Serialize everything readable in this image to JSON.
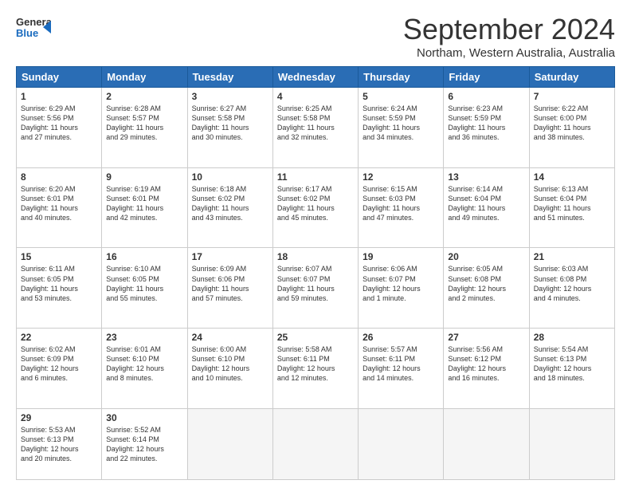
{
  "header": {
    "logo_line1": "General",
    "logo_line2": "Blue",
    "month": "September 2024",
    "location": "Northam, Western Australia, Australia"
  },
  "weekdays": [
    "Sunday",
    "Monday",
    "Tuesday",
    "Wednesday",
    "Thursday",
    "Friday",
    "Saturday"
  ],
  "weeks": [
    [
      {
        "day": "1",
        "info": "Sunrise: 6:29 AM\nSunset: 5:56 PM\nDaylight: 11 hours\nand 27 minutes."
      },
      {
        "day": "2",
        "info": "Sunrise: 6:28 AM\nSunset: 5:57 PM\nDaylight: 11 hours\nand 29 minutes."
      },
      {
        "day": "3",
        "info": "Sunrise: 6:27 AM\nSunset: 5:58 PM\nDaylight: 11 hours\nand 30 minutes."
      },
      {
        "day": "4",
        "info": "Sunrise: 6:25 AM\nSunset: 5:58 PM\nDaylight: 11 hours\nand 32 minutes."
      },
      {
        "day": "5",
        "info": "Sunrise: 6:24 AM\nSunset: 5:59 PM\nDaylight: 11 hours\nand 34 minutes."
      },
      {
        "day": "6",
        "info": "Sunrise: 6:23 AM\nSunset: 5:59 PM\nDaylight: 11 hours\nand 36 minutes."
      },
      {
        "day": "7",
        "info": "Sunrise: 6:22 AM\nSunset: 6:00 PM\nDaylight: 11 hours\nand 38 minutes."
      }
    ],
    [
      {
        "day": "8",
        "info": "Sunrise: 6:20 AM\nSunset: 6:01 PM\nDaylight: 11 hours\nand 40 minutes."
      },
      {
        "day": "9",
        "info": "Sunrise: 6:19 AM\nSunset: 6:01 PM\nDaylight: 11 hours\nand 42 minutes."
      },
      {
        "day": "10",
        "info": "Sunrise: 6:18 AM\nSunset: 6:02 PM\nDaylight: 11 hours\nand 43 minutes."
      },
      {
        "day": "11",
        "info": "Sunrise: 6:17 AM\nSunset: 6:02 PM\nDaylight: 11 hours\nand 45 minutes."
      },
      {
        "day": "12",
        "info": "Sunrise: 6:15 AM\nSunset: 6:03 PM\nDaylight: 11 hours\nand 47 minutes."
      },
      {
        "day": "13",
        "info": "Sunrise: 6:14 AM\nSunset: 6:04 PM\nDaylight: 11 hours\nand 49 minutes."
      },
      {
        "day": "14",
        "info": "Sunrise: 6:13 AM\nSunset: 6:04 PM\nDaylight: 11 hours\nand 51 minutes."
      }
    ],
    [
      {
        "day": "15",
        "info": "Sunrise: 6:11 AM\nSunset: 6:05 PM\nDaylight: 11 hours\nand 53 minutes."
      },
      {
        "day": "16",
        "info": "Sunrise: 6:10 AM\nSunset: 6:05 PM\nDaylight: 11 hours\nand 55 minutes."
      },
      {
        "day": "17",
        "info": "Sunrise: 6:09 AM\nSunset: 6:06 PM\nDaylight: 11 hours\nand 57 minutes."
      },
      {
        "day": "18",
        "info": "Sunrise: 6:07 AM\nSunset: 6:07 PM\nDaylight: 11 hours\nand 59 minutes."
      },
      {
        "day": "19",
        "info": "Sunrise: 6:06 AM\nSunset: 6:07 PM\nDaylight: 12 hours\nand 1 minute."
      },
      {
        "day": "20",
        "info": "Sunrise: 6:05 AM\nSunset: 6:08 PM\nDaylight: 12 hours\nand 2 minutes."
      },
      {
        "day": "21",
        "info": "Sunrise: 6:03 AM\nSunset: 6:08 PM\nDaylight: 12 hours\nand 4 minutes."
      }
    ],
    [
      {
        "day": "22",
        "info": "Sunrise: 6:02 AM\nSunset: 6:09 PM\nDaylight: 12 hours\nand 6 minutes."
      },
      {
        "day": "23",
        "info": "Sunrise: 6:01 AM\nSunset: 6:10 PM\nDaylight: 12 hours\nand 8 minutes."
      },
      {
        "day": "24",
        "info": "Sunrise: 6:00 AM\nSunset: 6:10 PM\nDaylight: 12 hours\nand 10 minutes."
      },
      {
        "day": "25",
        "info": "Sunrise: 5:58 AM\nSunset: 6:11 PM\nDaylight: 12 hours\nand 12 minutes."
      },
      {
        "day": "26",
        "info": "Sunrise: 5:57 AM\nSunset: 6:11 PM\nDaylight: 12 hours\nand 14 minutes."
      },
      {
        "day": "27",
        "info": "Sunrise: 5:56 AM\nSunset: 6:12 PM\nDaylight: 12 hours\nand 16 minutes."
      },
      {
        "day": "28",
        "info": "Sunrise: 5:54 AM\nSunset: 6:13 PM\nDaylight: 12 hours\nand 18 minutes."
      }
    ],
    [
      {
        "day": "29",
        "info": "Sunrise: 5:53 AM\nSunset: 6:13 PM\nDaylight: 12 hours\nand 20 minutes."
      },
      {
        "day": "30",
        "info": "Sunrise: 5:52 AM\nSunset: 6:14 PM\nDaylight: 12 hours\nand 22 minutes."
      },
      {
        "day": "",
        "info": ""
      },
      {
        "day": "",
        "info": ""
      },
      {
        "day": "",
        "info": ""
      },
      {
        "day": "",
        "info": ""
      },
      {
        "day": "",
        "info": ""
      }
    ]
  ]
}
